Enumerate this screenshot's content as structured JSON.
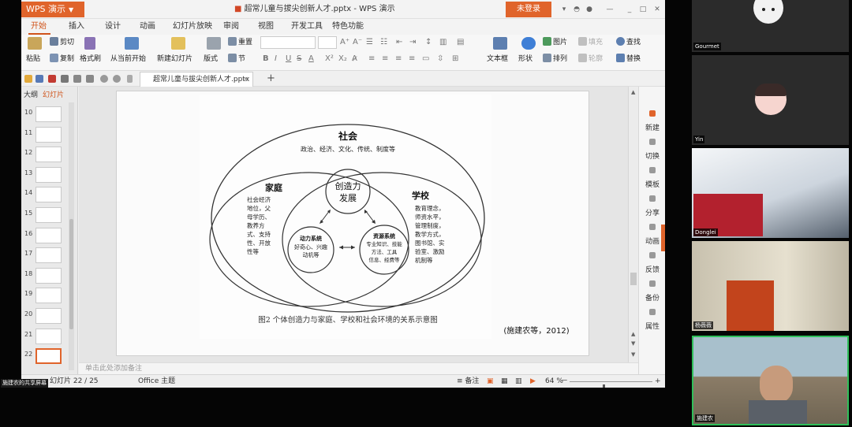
{
  "wps": {
    "app_name": "WPS 演示",
    "doc_title": "超常儿童与拔尖创新人才.pptx - WPS 演示",
    "login_label": "未登录",
    "menu": [
      "开始",
      "插入",
      "设计",
      "动画",
      "幻灯片放映",
      "审阅",
      "视图",
      "开发工具",
      "特色功能"
    ],
    "ribbon": {
      "paste": "粘贴",
      "cut": "剪切",
      "copy": "复制",
      "format_painter": "格式刷",
      "from_current": "从当前开始",
      "new_slide": "新建幻灯片",
      "layout": "版式",
      "reset": "重置",
      "section": "节",
      "textbox": "文本框",
      "shape": "形状",
      "picture": "图片",
      "arrange": "排列",
      "fill": "填充",
      "outline": "轮廓",
      "find": "查找",
      "replace": "替换"
    },
    "doc_tab": "超常儿童与拔尖创新人才.pptx",
    "pane_tabs": {
      "outline": "大纲",
      "slides": "幻灯片"
    },
    "thumbnails": [
      "10",
      "11",
      "12",
      "13",
      "14",
      "15",
      "16",
      "17",
      "18",
      "19",
      "20",
      "21",
      "22"
    ],
    "selected_slide": "22",
    "task_pane": [
      "新建",
      "切换",
      "模板",
      "分享",
      "动画",
      "反馈",
      "备份",
      "属性"
    ],
    "notes_placeholder": "单击此处添加备注",
    "status": {
      "slide_counter": "幻灯片 22 / 25",
      "theme": "Office 主题",
      "notes": "备注",
      "zoom": "64 %",
      "zoom_minus": "－",
      "zoom_plus": "+"
    },
    "share_tag": "施建农的共享屏幕"
  },
  "slide": {
    "society_title": "社会",
    "society_items": "政治、经济、文化、传统、制度等",
    "family_title": "家庭",
    "family_items": [
      "社会经济",
      "地位，父",
      "母学历、",
      "教养方",
      "式、支持",
      "性、开放",
      "性等"
    ],
    "school_title": "学校",
    "school_items": [
      "教育理念，",
      "师资水平，",
      "管理制度，",
      "教学方式，",
      "图书馆、实",
      "验室、激励",
      "机制等"
    ],
    "creativity": [
      "创造力",
      "发展"
    ],
    "motivation_title": "动力系统",
    "motivation_items": [
      "好奇心、兴趣",
      "动机等"
    ],
    "resource_title": "资源系统",
    "resource_items": [
      "专业知识、技能",
      "方法、工具",
      "信息、经费等"
    ],
    "caption": "图2  个体创造力与家庭、学校和社会环境的关系示意图",
    "citation": "(施建农等，2012)"
  },
  "participants": [
    {
      "name": "Gourmet"
    },
    {
      "name": "Yin"
    },
    {
      "name": "Donglei"
    },
    {
      "name": "杨薇薇"
    },
    {
      "name": "施建农"
    }
  ]
}
